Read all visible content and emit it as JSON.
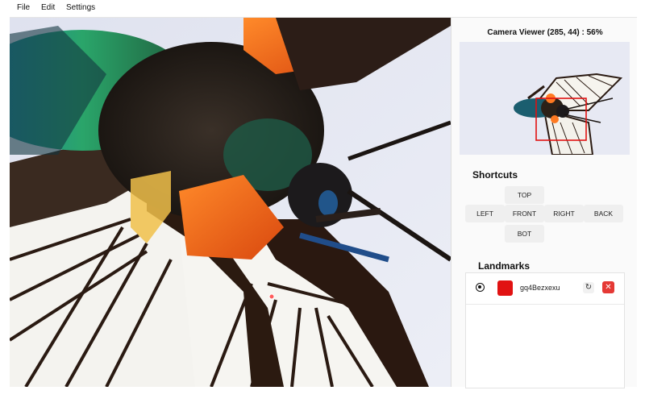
{
  "menu": {
    "items": [
      {
        "label": "File"
      },
      {
        "label": "Edit"
      },
      {
        "label": "Settings"
      }
    ]
  },
  "camera": {
    "title": "Camera Viewer (285, 44) : 56%"
  },
  "shortcuts": {
    "title": "Shortcuts",
    "top": "TOP",
    "left": "LEFT",
    "front": "FRONT",
    "right": "RIGHT",
    "back": "BACK",
    "bot": "BOT"
  },
  "landmarks": {
    "title": "Landmarks",
    "items": [
      {
        "name": "gq4Bezxexu",
        "color": "#e11212",
        "visible": true
      }
    ]
  },
  "colors": {
    "accent_red": "#e53935",
    "background": "#e9ebf4"
  }
}
